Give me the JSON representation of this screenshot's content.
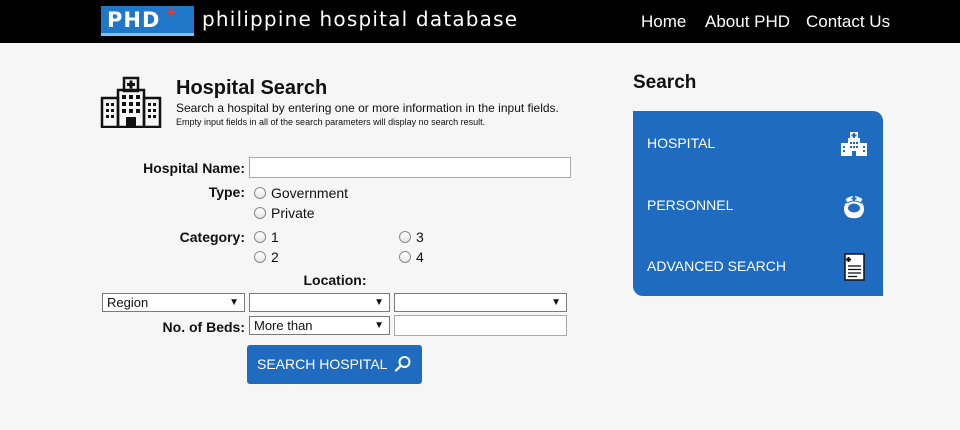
{
  "header": {
    "logo": {
      "text": "PHD",
      "plus": "+"
    },
    "site_title": "philippine hospital database",
    "nav": [
      "Home",
      "About PHD",
      "Contact Us"
    ]
  },
  "search": {
    "title": "Hospital Search",
    "subtitle": "Search a hospital by entering one or more information in the input fields.",
    "note": "Empty input fields in all of the search parameters will display no search result."
  },
  "form": {
    "hospital_name_label": "Hospital Name:",
    "hospital_name_value": "",
    "type_label": "Type:",
    "type_options": [
      "Government",
      "Private"
    ],
    "category_label": "Category:",
    "category_options": [
      "1",
      "2",
      "3",
      "4"
    ],
    "location_label": "Location:",
    "region_select": "Region",
    "province_select": "",
    "city_select": "",
    "beds_label": "No. of Beds:",
    "beds_select": "More than",
    "beds_value": "",
    "submit_label": "SEARCH HOSPITAL"
  },
  "sidebar": {
    "title": "Search",
    "items": [
      {
        "label": "HOSPITAL",
        "icon": "hospital-icon"
      },
      {
        "label": "PERSONNEL",
        "icon": "nurse-icon"
      },
      {
        "label": "ADVANCED SEARCH",
        "icon": "document-icon"
      }
    ]
  },
  "colors": {
    "topbar": "#000000",
    "accent_blue": "#1e6bbf",
    "logo_blue": "#1f77c9",
    "logo_plus": "#e23b2f",
    "background": "#f6f6f6"
  }
}
